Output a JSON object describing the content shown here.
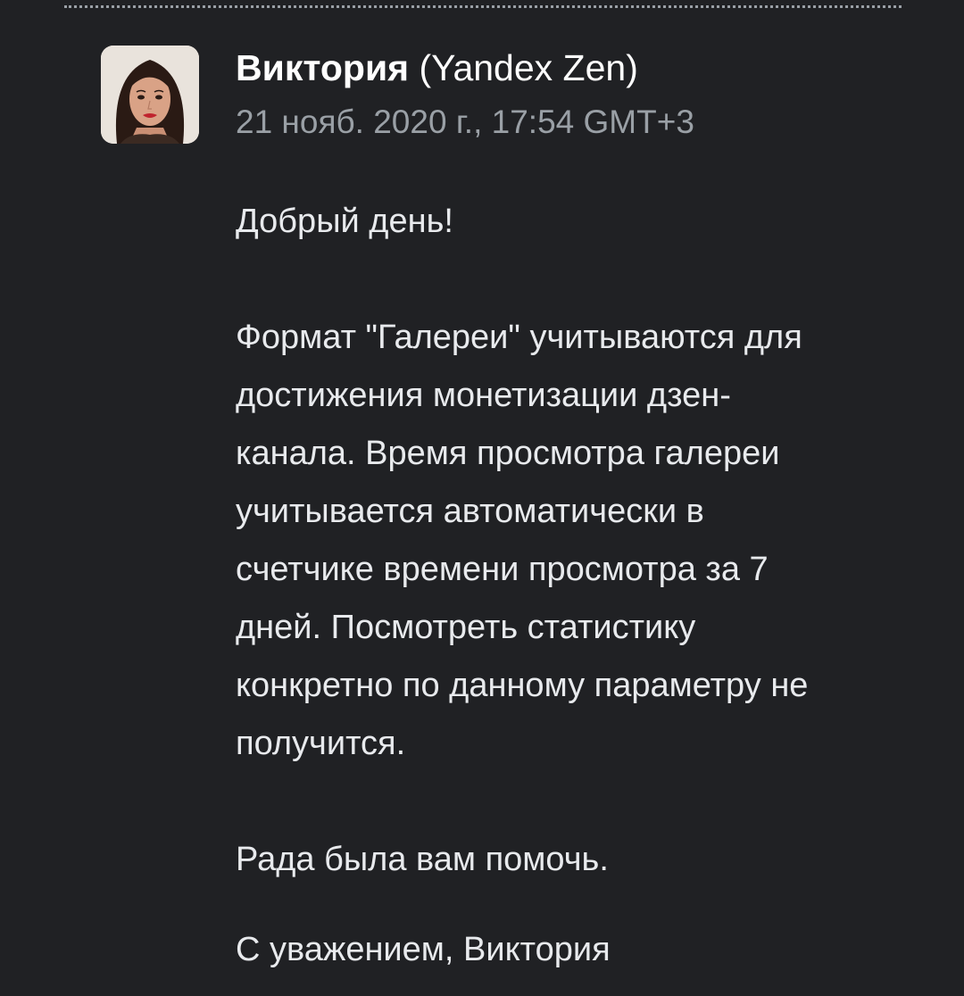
{
  "message": {
    "sender_name": "Виктория",
    "sender_org": " (Yandex Zen)",
    "date": "21 нояб. 2020 г., 17:54 GMT+3",
    "greeting": "Добрый день!",
    "body_text": "Формат \"Галереи\" учитываются для\nдостижения монетизации дзен-\nканала.  Время просмотра галереи\nучитывается автоматически в\nсчетчике времени просмотра за 7\nдней. Посмотреть статистику\nконкретно по данному параметру не\nполучится.",
    "closing": "Рада была вам помочь.",
    "signature": "С уважением, Виктория"
  }
}
